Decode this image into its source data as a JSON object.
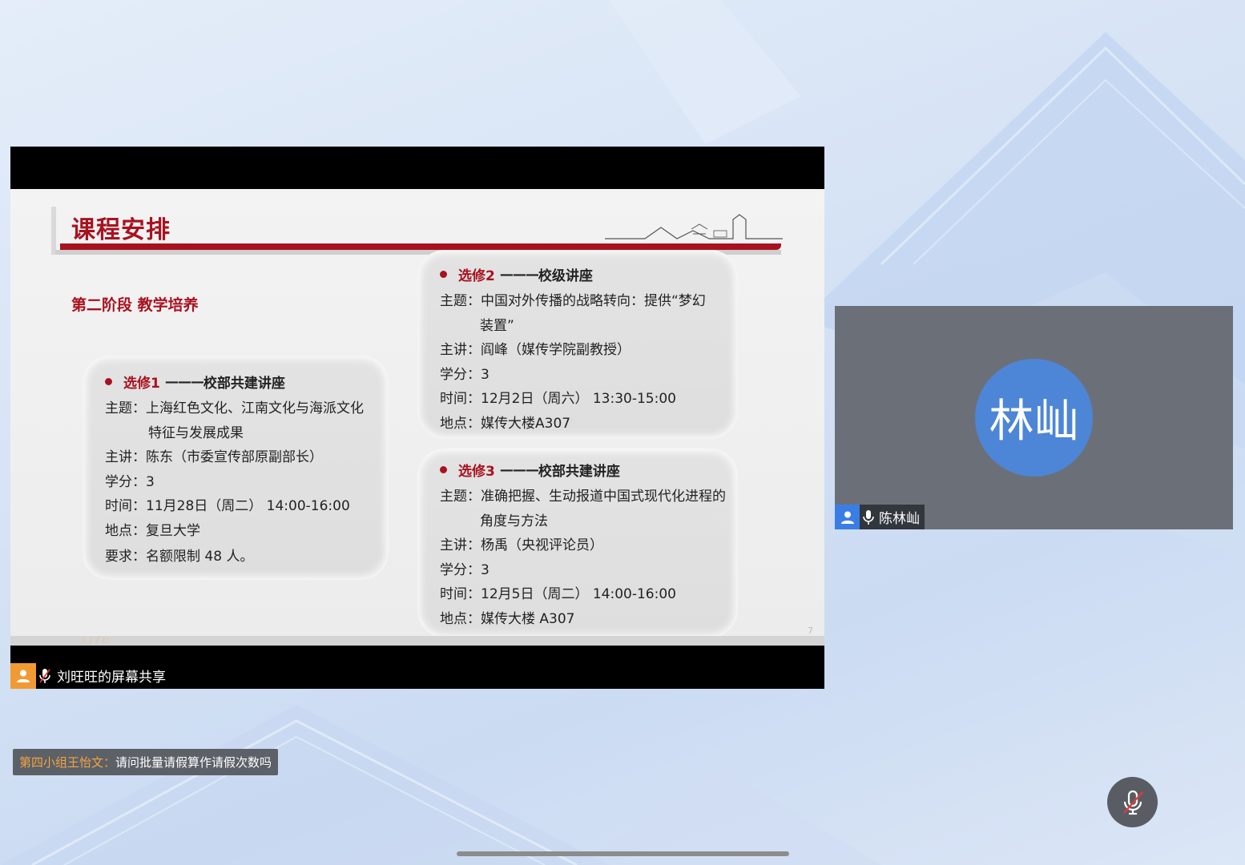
{
  "slide": {
    "title": "课程安排",
    "stage_heading": "第二阶段  教学培养",
    "page_number": "7",
    "footer_text": "SJTU",
    "cards": [
      {
        "tag": "选修1",
        "dash": "———",
        "kind": "校部共建讲座",
        "lines": [
          {
            "text": "主题：上海红色文化、江南文化与海派文化",
            "indent": false
          },
          {
            "text": "特征与发展成果",
            "indent": true
          },
          {
            "text": "主讲：陈东（市委宣传部原副部长）",
            "indent": false
          },
          {
            "text": "学分：3",
            "indent": false
          },
          {
            "text": "时间：11月28日（周二） 14:00-16:00",
            "indent": false
          },
          {
            "text": "地点：复旦大学",
            "indent": false
          },
          {
            "text": "要求：名额限制 48 人。",
            "indent": false
          }
        ]
      },
      {
        "tag": "选修2",
        "dash": "———",
        "kind": "校级讲座",
        "lines": [
          {
            "text": "主题：中国对外传播的战略转向：提供“梦幻",
            "indent": false
          },
          {
            "text": "装置”",
            "indent": true
          },
          {
            "text": "主讲：阎峰（媒传学院副教授）",
            "indent": false
          },
          {
            "text": "学分：3",
            "indent": false
          },
          {
            "text": "时间：12月2日（周六） 13:30-15:00",
            "indent": false
          },
          {
            "text": "地点：媒传大楼A307",
            "indent": false
          }
        ]
      },
      {
        "tag": "选修3",
        "dash": "———",
        "kind": "校部共建讲座",
        "lines": [
          {
            "text": "主题：准确把握、生动报道中国式现代化进程的",
            "indent": false
          },
          {
            "text": "角度与方法",
            "indent": true
          },
          {
            "text": "主讲：杨禹（央视评论员）",
            "indent": false
          },
          {
            "text": "学分：3",
            "indent": false
          },
          {
            "text": "时间：12月5日（周二） 14:00-16:00",
            "indent": false
          },
          {
            "text": "地点：媒传大楼 A307",
            "indent": false
          }
        ]
      }
    ]
  },
  "share": {
    "label": "刘旺旺的屏幕共享",
    "avatar_icon": "user-icon",
    "mic_icon": "mic-muted-icon"
  },
  "participant": {
    "avatar_text": "林屾",
    "name": "陈林屾",
    "avatar_color": "#4d86d6",
    "mic_icon": "mic-icon"
  },
  "chat": {
    "sender": "第四小组王怡文：",
    "message": "请问批量请假算作请假次数吗"
  },
  "controls": {
    "mute_icon": "mic-muted-icon"
  },
  "colors": {
    "accent_red": "#a8121f",
    "share_orange": "#f19a33",
    "participant_blue": "#3a7ee5"
  }
}
